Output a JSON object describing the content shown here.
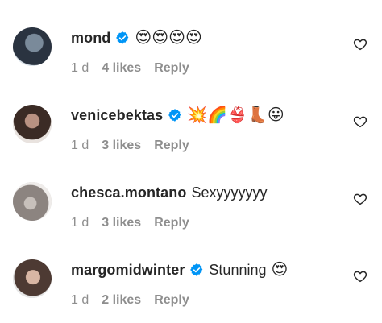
{
  "comments": [
    {
      "username": "mond",
      "verified": true,
      "text": "",
      "emoji": "😍😍😍😍",
      "time": "1 d",
      "likes": "4 likes",
      "reply": "Reply"
    },
    {
      "username": "venicebektas",
      "verified": true,
      "text": "",
      "emoji": "💥🌈👙👢😛",
      "time": "1 d",
      "likes": "3 likes",
      "reply": "Reply"
    },
    {
      "username": "chesca.montano",
      "verified": false,
      "text": "Sexyyyyyyy",
      "emoji": "",
      "time": "1 d",
      "likes": "3 likes",
      "reply": "Reply"
    },
    {
      "username": "margomidwinter",
      "verified": true,
      "text": "Stunning",
      "emoji": "😍",
      "time": "1 d",
      "likes": "2 likes",
      "reply": "Reply"
    }
  ],
  "colors": {
    "verified": "#0095F6",
    "muted": "#8E8E8E",
    "text": "#262626"
  },
  "icons": {
    "verified": "verified-badge-icon",
    "like": "heart-outline-icon"
  }
}
